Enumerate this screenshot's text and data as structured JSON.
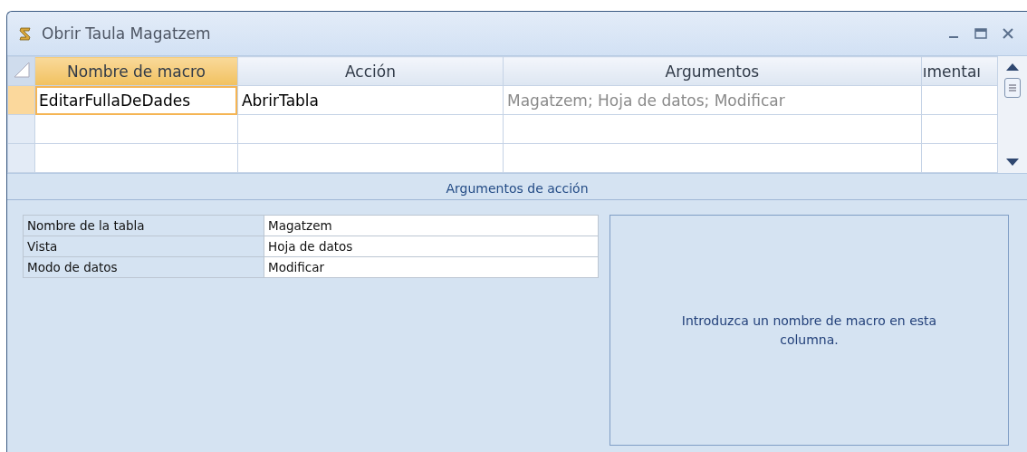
{
  "window": {
    "title": "Obrir Taula Magatzem"
  },
  "grid": {
    "columns": [
      {
        "label": "Nombre de macro",
        "selected": true
      },
      {
        "label": "Acción",
        "selected": false
      },
      {
        "label": "Argumentos",
        "selected": false
      },
      {
        "label": "ımentaı",
        "selected": false
      }
    ],
    "rows": [
      {
        "selected": true,
        "cells": [
          "EditarFullaDeDades",
          "AbrirTabla",
          "Magatzem; Hoja de datos; Modificar",
          ""
        ]
      },
      {
        "selected": false,
        "cells": [
          "",
          "",
          "",
          ""
        ]
      },
      {
        "selected": false,
        "cells": [
          "",
          "",
          "",
          ""
        ]
      }
    ]
  },
  "section_title": "Argumentos de acción",
  "arguments": [
    {
      "label": "Nombre de la tabla",
      "value": "Magatzem"
    },
    {
      "label": "Vista",
      "value": "Hoja de datos"
    },
    {
      "label": "Modo de datos",
      "value": "Modificar"
    }
  ],
  "help_text": "Introduzca un nombre de macro en esta columna."
}
